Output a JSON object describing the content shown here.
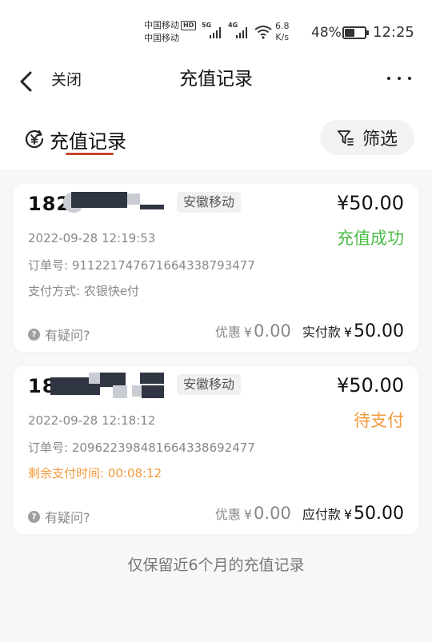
{
  "status_bar": {
    "carrier_1": "中国移动",
    "carrier_2": "中国移动",
    "hd": "HD",
    "sig1_label": "5G",
    "sig2_label": "4G",
    "speed_value": "6.8",
    "speed_unit": "K/s",
    "battery_percent": "48%",
    "battery_level": 0.48,
    "time": "12:25"
  },
  "nav": {
    "close_label": "关闭",
    "title": "充值记录"
  },
  "tabs": {
    "active_label": "充值记录",
    "filter_label": "筛选"
  },
  "colors": {
    "accent": "#c8442b",
    "success": "#4cbc48",
    "pending": "#f39a3c"
  },
  "records": [
    {
      "phone_visible": "182",
      "carrier_tag": "安徽移动",
      "amount": "¥50.00",
      "time": "2022-09-28 12:19:53",
      "status": "充值成功",
      "order": "订单号: 911221747671664338793477",
      "detail": "支付方式: 农银快e付",
      "help": "有疑问?",
      "discount_label": "优惠",
      "discount_yen": "¥",
      "discount_value": "0.00",
      "pay_label": "实付款",
      "pay_yen": "¥",
      "pay_value": "50.00"
    },
    {
      "phone_visible": "18",
      "carrier_tag": "安徽移动",
      "amount": "¥50.00",
      "time": "2022-09-28 12:18:12",
      "status": "待支付",
      "order": "订单号: 209622398481664338692477",
      "detail": "剩余支付时间: 00:08:12",
      "help": "有疑问?",
      "discount_label": "优惠",
      "discount_yen": "¥",
      "discount_value": "0.00",
      "pay_label": "应付款",
      "pay_yen": "¥",
      "pay_value": "50.00"
    }
  ],
  "footer_note": "仅保留近6个月的充值记录"
}
